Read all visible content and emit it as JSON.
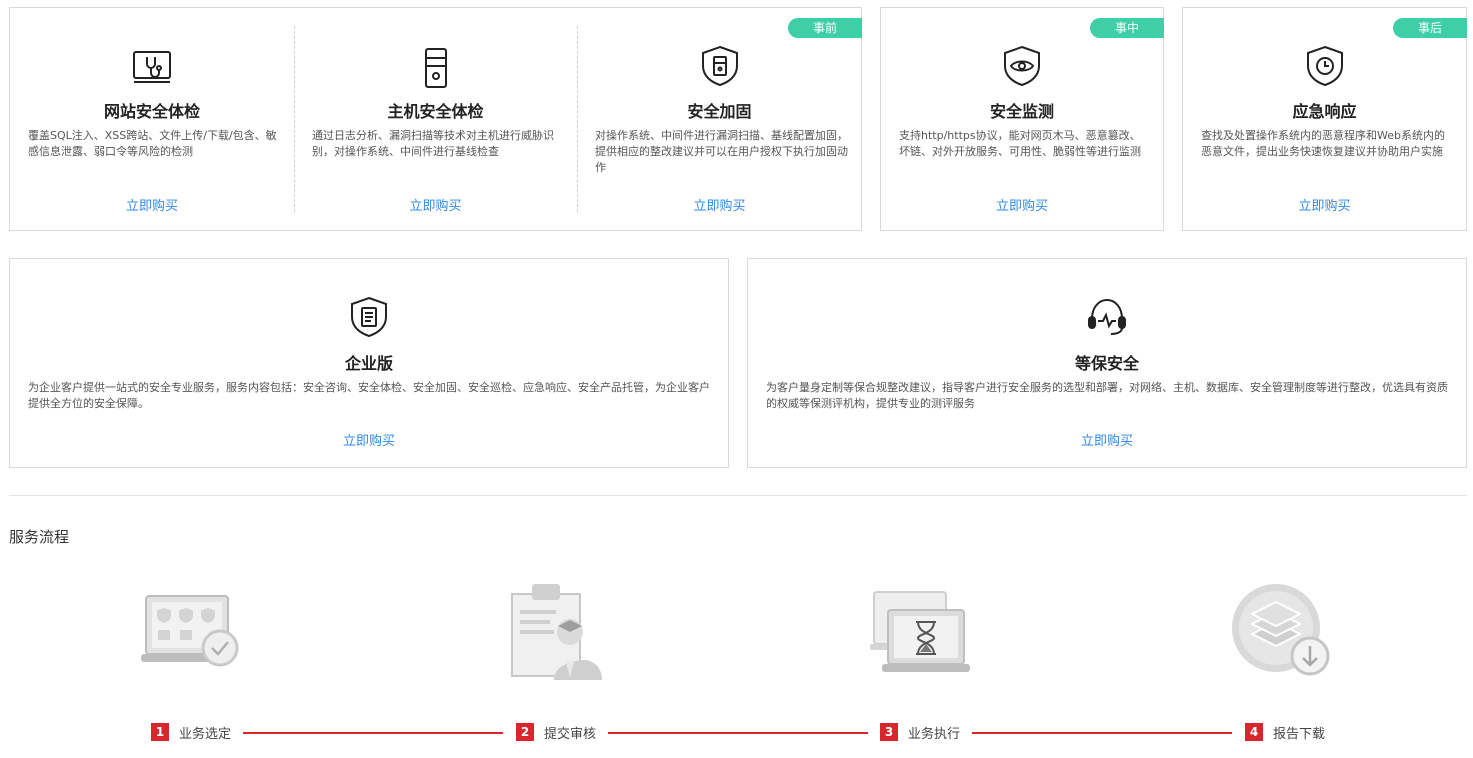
{
  "phases": {
    "before": "事前",
    "during": "事中",
    "after": "事后"
  },
  "buy_label": "立即购买",
  "services": {
    "web_check": {
      "title": "网站安全体检",
      "desc": "覆盖SQL注入、XSS跨站、文件上传/下载/包含、敏感信息泄露、弱口令等风险的检测",
      "icon": "monitor-stethoscope-icon"
    },
    "host_check": {
      "title": "主机安全体检",
      "desc": "通过日志分析、漏洞扫描等技术对主机进行威胁识别，对操作系统、中间件进行基线检查",
      "icon": "server-tower-icon"
    },
    "hardening": {
      "title": "安全加固",
      "desc": "对操作系统、中间件进行漏洞扫描、基线配置加固，提供相应的整改建议并可以在用户授权下执行加固动作",
      "icon": "shield-server-icon"
    },
    "monitoring": {
      "title": "安全监测",
      "desc": "支持http/https协议，能对网页木马、恶意篡改、坏链、对外开放服务、可用性、脆弱性等进行监测",
      "icon": "shield-eye-icon"
    },
    "response": {
      "title": "应急响应",
      "desc": "查找及处置操作系统内的恶意程序和Web系统内的恶意文件，提出业务快速恢复建议并协助用户实施",
      "icon": "shield-clock-icon"
    },
    "enterprise": {
      "title": "企业版",
      "desc": "为企业客户提供一站式的安全专业服务，服务内容包括：安全咨询、安全体检、安全加固、安全巡检、应急响应、安全产品托管，为企业客户提供全方位的安全保障。",
      "icon": "shield-document-icon"
    },
    "compliance": {
      "title": "等保安全",
      "desc": "为客户量身定制等保合规整改建议，指导客户进行安全服务的选型和部署，对网络、主机、数据库、安全管理制度等进行整改，优选具有资质的权威等保测评机构，提供专业的测评服务",
      "icon": "headset-icon"
    }
  },
  "process": {
    "title": "服务流程",
    "steps": [
      {
        "num": "1",
        "label": "业务选定",
        "icon": "laptop-check-icon"
      },
      {
        "num": "2",
        "label": "提交审核",
        "icon": "clipboard-agent-icon"
      },
      {
        "num": "3",
        "label": "业务执行",
        "icon": "laptop-hourglass-icon"
      },
      {
        "num": "4",
        "label": "报告下载",
        "icon": "layers-download-icon"
      }
    ],
    "accent_color": "#d7262c"
  },
  "colors": {
    "tag": "#3fcfa6",
    "link": "#2e8ae6",
    "border": "#d9d9d9"
  }
}
